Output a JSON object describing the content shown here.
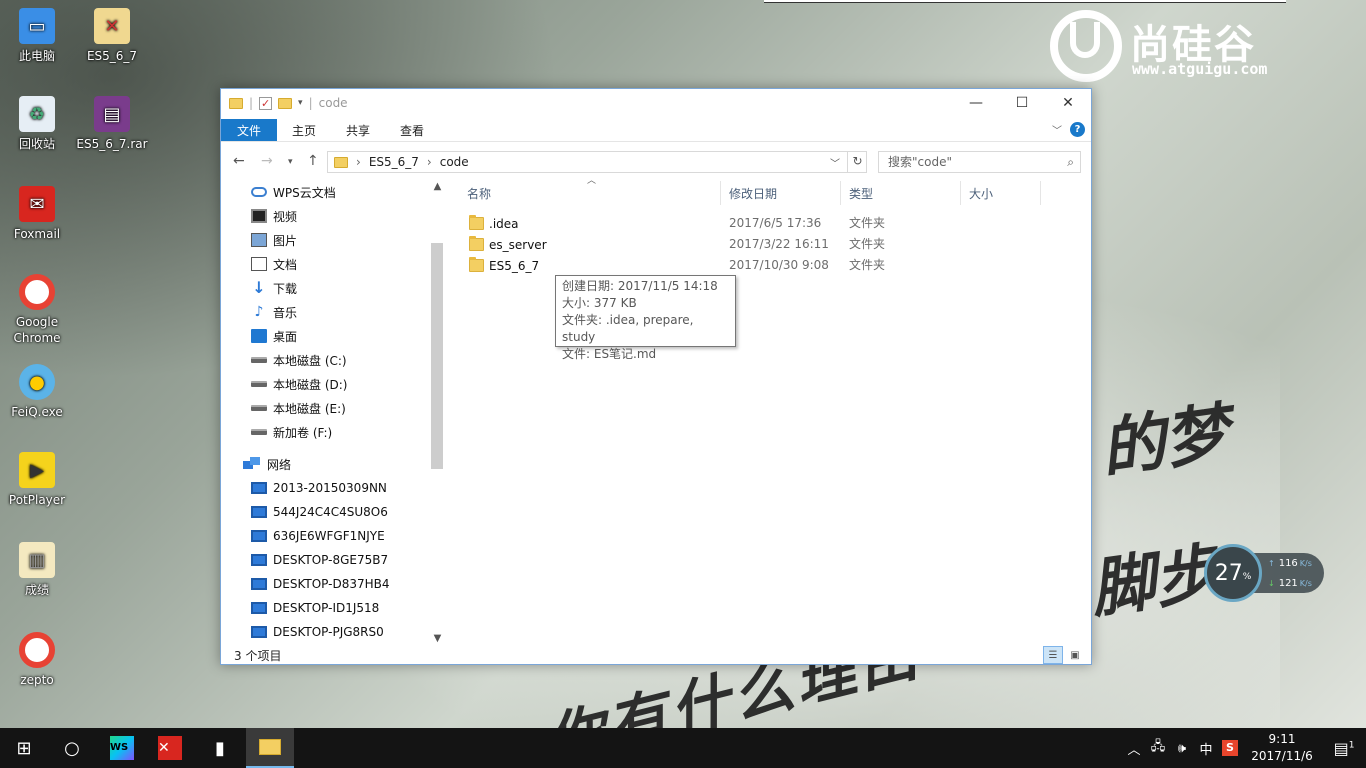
{
  "desktop": {
    "icons": [
      {
        "label": "此电脑",
        "icon": "computer-icon"
      },
      {
        "label": "ES5_6_7",
        "icon": "document-icon"
      },
      {
        "label": "回收站",
        "icon": "recycle-bin-icon"
      },
      {
        "label": "ES5_6_7.rar",
        "icon": "rar-archive-icon"
      },
      {
        "label": "Foxmail",
        "icon": "foxmail-icon"
      },
      {
        "label": "Google Chrome",
        "icon": "chrome-icon"
      },
      {
        "label": "FeiQ.exe",
        "icon": "feiq-icon"
      },
      {
        "label": "PotPlayer",
        "icon": "potplayer-icon"
      },
      {
        "label": "成绩",
        "icon": "document-icon"
      },
      {
        "label": "zepto",
        "icon": "chrome-icon"
      }
    ],
    "logo": {
      "cn": "尚硅谷",
      "url": "www.atguigu.com"
    },
    "handwriting": [
      "的梦",
      "脚步",
      "你有什么理由"
    ]
  },
  "window": {
    "title": "code",
    "ribbon_tabs": [
      "文件",
      "主页",
      "共享",
      "查看"
    ],
    "path": [
      "ES5_6_7",
      "code"
    ],
    "search_placeholder": "搜索\"code\"",
    "nav": [
      {
        "label": "WPS云文档",
        "icon": "cloud-icon"
      },
      {
        "label": "视频",
        "icon": "video-icon"
      },
      {
        "label": "图片",
        "icon": "picture-icon"
      },
      {
        "label": "文档",
        "icon": "document-icon"
      },
      {
        "label": "下载",
        "icon": "download-icon"
      },
      {
        "label": "音乐",
        "icon": "music-icon"
      },
      {
        "label": "桌面",
        "icon": "desktop-icon"
      },
      {
        "label": "本地磁盘 (C:)",
        "icon": "drive-icon"
      },
      {
        "label": "本地磁盘 (D:)",
        "icon": "drive-icon"
      },
      {
        "label": "本地磁盘 (E:)",
        "icon": "drive-icon"
      },
      {
        "label": "新加卷 (F:)",
        "icon": "drive-icon"
      },
      {
        "label": "网络",
        "icon": "network-icon"
      },
      {
        "label": "2013-20150309NN",
        "icon": "pc-icon"
      },
      {
        "label": "544J24C4C4SU8O6",
        "icon": "pc-icon"
      },
      {
        "label": "636JE6WFGF1NJYE",
        "icon": "pc-icon"
      },
      {
        "label": "DESKTOP-8GE75B7",
        "icon": "pc-icon"
      },
      {
        "label": "DESKTOP-D837HB4",
        "icon": "pc-icon"
      },
      {
        "label": "DESKTOP-ID1J518",
        "icon": "pc-icon"
      },
      {
        "label": "DESKTOP-PJG8RS0",
        "icon": "pc-icon"
      }
    ],
    "columns": [
      "名称",
      "修改日期",
      "类型",
      "大小"
    ],
    "files": [
      {
        "name": ".idea",
        "date": "2017/6/5 17:36",
        "type": "文件夹"
      },
      {
        "name": "es_server",
        "date": "2017/3/22 16:11",
        "type": "文件夹"
      },
      {
        "name": "ES5_6_7",
        "date": "2017/10/30 9:08",
        "type": "文件夹"
      }
    ],
    "tooltip": [
      "创建日期: 2017/11/5 14:18",
      "大小: 377 KB",
      "文件夹: .idea, prepare, study",
      "文件: ES笔记.md"
    ],
    "status": "3 个项目"
  },
  "netwidget": {
    "percent": "27",
    "up": "116",
    "down": "121",
    "unit": "K/s"
  },
  "taskbar": {
    "apps": [
      "windows-start-icon",
      "cortana-icon",
      "webstorm-icon",
      "xmind-icon",
      "app-icon",
      "file-explorer-icon"
    ],
    "ime": "中",
    "time": "9:11",
    "date": "2017/11/6",
    "notification_count": "1"
  }
}
